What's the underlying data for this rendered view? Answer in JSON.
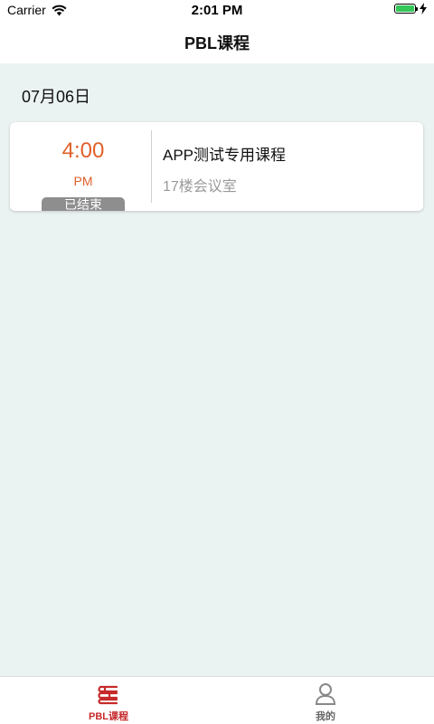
{
  "status_bar": {
    "carrier": "Carrier",
    "time": "2:01 PM",
    "battery_color": "#34c759"
  },
  "nav": {
    "title": "PBL课程"
  },
  "content": {
    "background": "#ebf2f2",
    "date": "07月06日",
    "courses": [
      {
        "time": "4:00",
        "ampm": "PM",
        "status": "已结束",
        "title": "APP测试专用课程",
        "location": "17楼会议室"
      }
    ]
  },
  "tab_bar": {
    "active_color": "#c62a2a",
    "tabs": [
      {
        "label": "PBL课程",
        "icon": "books-stack-icon",
        "active": true
      },
      {
        "label": "我的",
        "icon": "user-profile-icon",
        "active": false
      }
    ]
  }
}
